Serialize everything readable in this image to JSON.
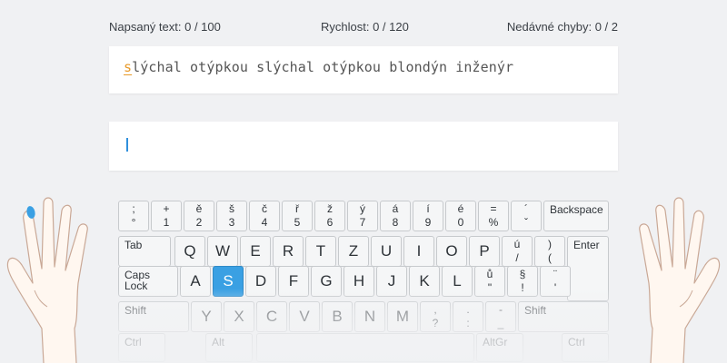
{
  "stats": {
    "typed": "Napsaný text: 0 / 100",
    "speed": "Rychlost: 0 / 120",
    "errors": "Nedávné chyby: 0 / 2"
  },
  "lesson": {
    "current_char": "s",
    "rest": "lýchal otýpkou slýchal otýpkou blondýn inženýr"
  },
  "colors": {
    "accent": "#3aa0e3",
    "current_char": "#e89a2a",
    "background": "#f0f1f3"
  },
  "keyboard": {
    "row1": [
      {
        "top": ";",
        "bot": "°"
      },
      {
        "top": "+",
        "bot": "1"
      },
      {
        "top": "ě",
        "bot": "2"
      },
      {
        "top": "š",
        "bot": "3"
      },
      {
        "top": "č",
        "bot": "4"
      },
      {
        "top": "ř",
        "bot": "5"
      },
      {
        "top": "ž",
        "bot": "6"
      },
      {
        "top": "ý",
        "bot": "7"
      },
      {
        "top": "á",
        "bot": "8"
      },
      {
        "top": "í",
        "bot": "9"
      },
      {
        "top": "é",
        "bot": "0"
      },
      {
        "top": "=",
        "bot": "%"
      },
      {
        "top": "´",
        "bot": "ˇ"
      }
    ],
    "backspace": "Backspace",
    "tab": "Tab",
    "row2": [
      "Q",
      "W",
      "E",
      "R",
      "T",
      "Z",
      "U",
      "I",
      "O",
      "P"
    ],
    "row2_extra": [
      {
        "top": "ú",
        "bot": "/"
      },
      {
        "top": ")",
        "bot": "("
      }
    ],
    "enter": "Enter",
    "caps": "Caps\nLock",
    "row3": [
      "A",
      "S",
      "D",
      "F",
      "G",
      "H",
      "J",
      "K",
      "L"
    ],
    "row3_extra": [
      {
        "top": "ů",
        "bot": "\""
      },
      {
        "top": "§",
        "bot": "!"
      },
      {
        "top": "¨",
        "bot": "'"
      }
    ],
    "shift_left": "Shift",
    "row4": [
      "Y",
      "X",
      "C",
      "V",
      "B",
      "N",
      "M"
    ],
    "row4_extra": [
      {
        "top": ",",
        "bot": "?"
      },
      {
        "top": ".",
        "bot": ":"
      },
      {
        "top": "-",
        "bot": "_"
      }
    ],
    "shift_right": "Shift",
    "ctrl_left": "Ctrl",
    "alt": "Alt",
    "altgr": "AltGr",
    "ctrl_right": "Ctrl",
    "highlighted_key": "S"
  },
  "hands": {
    "active_finger": "left-little-finger"
  }
}
